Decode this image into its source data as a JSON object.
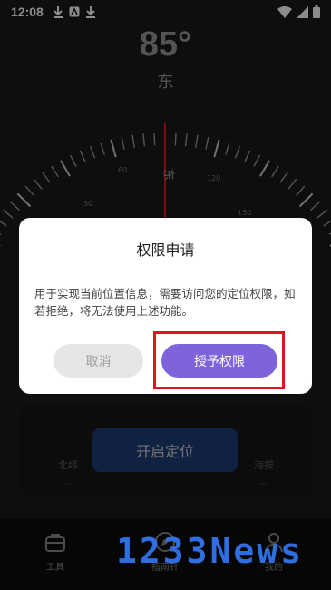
{
  "status_bar": {
    "time": "12:08"
  },
  "compass": {
    "degree": "85°",
    "direction": "东",
    "dial_label_east": "东",
    "tick_labels": [
      "60",
      "30",
      "120",
      "150"
    ],
    "accent_color": "#e0141e"
  },
  "location_card": {
    "button_label": "开启定位",
    "left_label": "北纬",
    "right_label": "海拔",
    "left_value": "--",
    "right_value": "--"
  },
  "bottom_nav": {
    "items": [
      {
        "label": "工具",
        "icon": "toolbox-icon"
      },
      {
        "label": "指南针",
        "icon": "compass-icon"
      },
      {
        "label": "我的",
        "icon": "user-icon"
      }
    ]
  },
  "dialog": {
    "title": "权限申请",
    "message": "用于实现当前位置信息，需要访问您的定位权限，如若拒绝，将无法使用上述功能。",
    "cancel_label": "取消",
    "grant_label": "授予权限",
    "grant_color": "#7e63dc",
    "highlight_color": "#e0141e"
  },
  "watermark": {
    "text": "1233News"
  }
}
